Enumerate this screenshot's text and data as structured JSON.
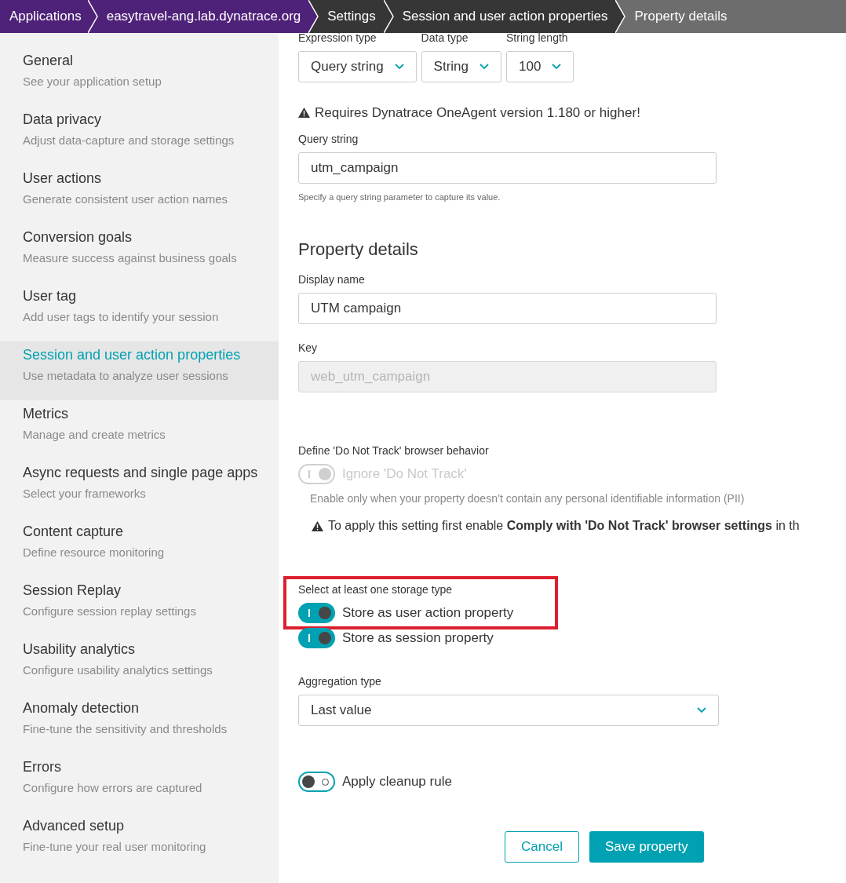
{
  "breadcrumbs": [
    {
      "label": "Applications",
      "kind": "app"
    },
    {
      "label": "easytravel-ang.lab.dynatrace.org",
      "kind": "app"
    },
    {
      "label": "Settings",
      "kind": "settings"
    },
    {
      "label": "Session and user action properties",
      "kind": "settings"
    },
    {
      "label": "Property details",
      "kind": "current"
    }
  ],
  "sidebar": {
    "items": [
      {
        "title": "General",
        "subtitle": "See your application setup",
        "selected": false
      },
      {
        "title": "Data privacy",
        "subtitle": "Adjust data-capture and storage settings",
        "selected": false
      },
      {
        "title": "User actions",
        "subtitle": "Generate consistent user action names",
        "selected": false
      },
      {
        "title": "Conversion goals",
        "subtitle": "Measure success against business goals",
        "selected": false
      },
      {
        "title": "User tag",
        "subtitle": "Add user tags to identify your session",
        "selected": false
      },
      {
        "title": "Session and user action properties",
        "subtitle": "Use metadata to analyze user sessions",
        "selected": true
      },
      {
        "title": "Metrics",
        "subtitle": "Manage and create metrics",
        "selected": false
      },
      {
        "title": "Async requests and single page apps",
        "subtitle": "Select your frameworks",
        "selected": false
      },
      {
        "title": "Content capture",
        "subtitle": "Define resource monitoring",
        "selected": false
      },
      {
        "title": "Session Replay",
        "subtitle": "Configure session replay settings",
        "selected": false
      },
      {
        "title": "Usability analytics",
        "subtitle": "Configure usability analytics settings",
        "selected": false
      },
      {
        "title": "Anomaly detection",
        "subtitle": "Fine-tune the sensitivity and thresholds",
        "selected": false
      },
      {
        "title": "Errors",
        "subtitle": "Configure how errors are captured",
        "selected": false
      },
      {
        "title": "Advanced setup",
        "subtitle": "Fine-tune your real user monitoring",
        "selected": false
      }
    ]
  },
  "selects": [
    {
      "label": "Expression type",
      "value": "Query string"
    },
    {
      "label": "Data type",
      "value": "String"
    },
    {
      "label": "String length",
      "value": "100"
    }
  ],
  "agent_warning": "Requires Dynatrace OneAgent version 1.180 or higher!",
  "query_string": {
    "label": "Query string",
    "value": "utm_campaign",
    "hint": "Specify a query string parameter to capture its value."
  },
  "property_details": {
    "heading": "Property details",
    "display_name": {
      "label": "Display name",
      "value": "UTM campaign"
    },
    "key": {
      "label": "Key",
      "value": "web_utm_campaign",
      "disabled": true
    }
  },
  "do_not_track": {
    "label": "Define 'Do Not Track' browser behavior",
    "toggle": {
      "label": "Ignore 'Do Not Track'",
      "on": true,
      "disabled": true
    },
    "info": "Enable only when your property doesn’t contain any personal identifiable information (PII)",
    "warning": "To apply this setting first enable **Comply with 'Do Not Track' browser settings** in th"
  },
  "storage": {
    "label": "Select at least one storage type",
    "toggles": [
      {
        "label": "Store as user action property",
        "on": true,
        "highlighted": true
      },
      {
        "label": "Store as session property",
        "on": true,
        "highlighted": false
      }
    ]
  },
  "aggregation": {
    "label": "Aggregation type",
    "value": "Last value"
  },
  "cleanup": {
    "label": "Apply cleanup rule",
    "on": false
  },
  "buttons": [
    {
      "label": "Cancel",
      "kind": "secondary"
    },
    {
      "label": "Save property",
      "kind": "primary"
    }
  ]
}
